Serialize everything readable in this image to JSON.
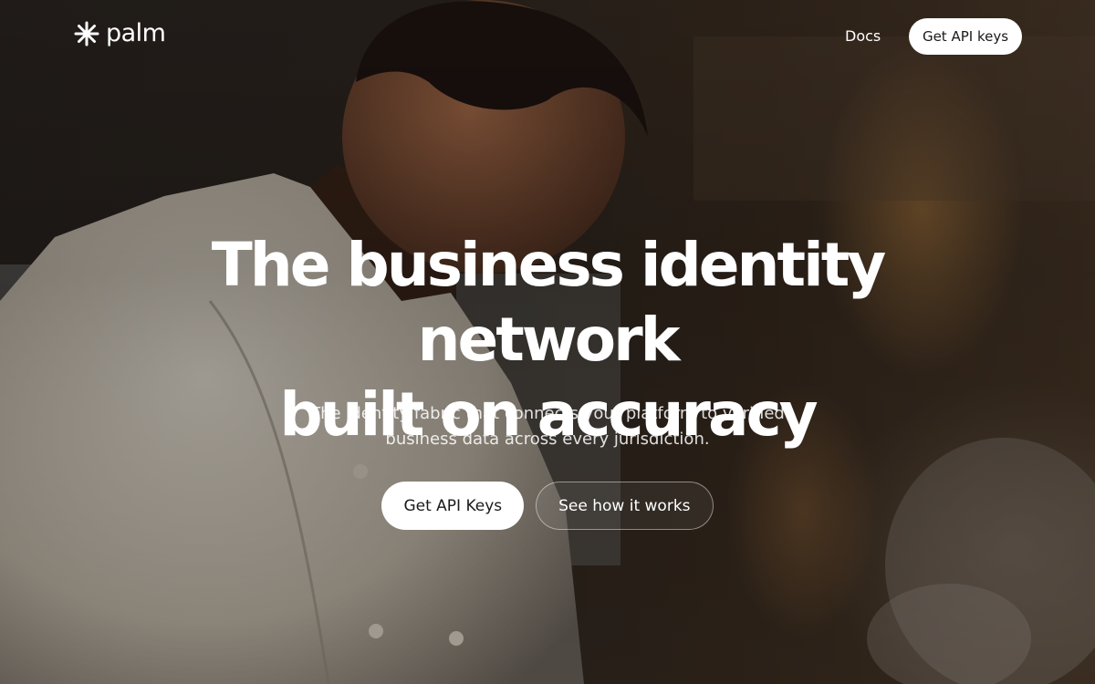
{
  "brand": {
    "name": "palm"
  },
  "nav": {
    "docs_label": "Docs",
    "cta_label": "Get API keys"
  },
  "hero": {
    "headline_line1": "The business identity network",
    "headline_line2": "built on accuracy",
    "subhead_line1": "The identity fabric that connects your platform to verified",
    "subhead_line2": "business data across every jurisdiction.",
    "primary_label": "Get API Keys",
    "secondary_label": "See how it works"
  },
  "colors": {
    "text": "#ffffff",
    "button_bg": "#ffffff",
    "button_text": "#1a1a1a"
  },
  "icons": [
    "asterisk-logo-icon"
  ]
}
